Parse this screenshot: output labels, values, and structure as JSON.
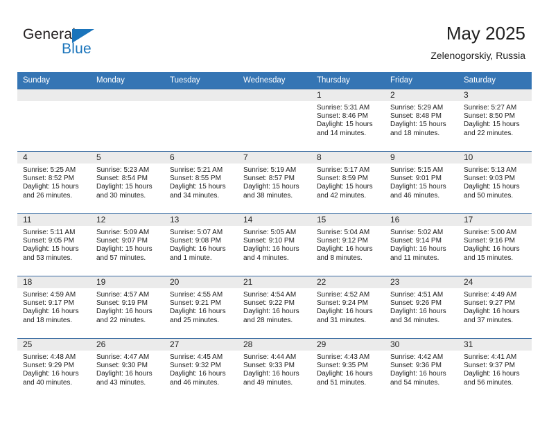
{
  "brand": {
    "name_top": "General",
    "name_bottom": "Blue",
    "accent_color": "#1a74bb"
  },
  "header": {
    "title": "May 2025",
    "subtitle": "Zelenogorskiy, Russia"
  },
  "theme": {
    "header_row_bg": "#3575b4",
    "grid_line": "#35689f",
    "daynum_band": "#ebebeb"
  },
  "weekdays": [
    "Sunday",
    "Monday",
    "Tuesday",
    "Wednesday",
    "Thursday",
    "Friday",
    "Saturday"
  ],
  "weeks": [
    [
      {
        "day": "",
        "empty": true
      },
      {
        "day": "",
        "empty": true
      },
      {
        "day": "",
        "empty": true
      },
      {
        "day": "",
        "empty": true
      },
      {
        "day": "1",
        "sunrise": "Sunrise: 5:31 AM",
        "sunset": "Sunset: 8:46 PM",
        "daylight1": "Daylight: 15 hours",
        "daylight2": "and 14 minutes."
      },
      {
        "day": "2",
        "sunrise": "Sunrise: 5:29 AM",
        "sunset": "Sunset: 8:48 PM",
        "daylight1": "Daylight: 15 hours",
        "daylight2": "and 18 minutes."
      },
      {
        "day": "3",
        "sunrise": "Sunrise: 5:27 AM",
        "sunset": "Sunset: 8:50 PM",
        "daylight1": "Daylight: 15 hours",
        "daylight2": "and 22 minutes."
      }
    ],
    [
      {
        "day": "4",
        "sunrise": "Sunrise: 5:25 AM",
        "sunset": "Sunset: 8:52 PM",
        "daylight1": "Daylight: 15 hours",
        "daylight2": "and 26 minutes."
      },
      {
        "day": "5",
        "sunrise": "Sunrise: 5:23 AM",
        "sunset": "Sunset: 8:54 PM",
        "daylight1": "Daylight: 15 hours",
        "daylight2": "and 30 minutes."
      },
      {
        "day": "6",
        "sunrise": "Sunrise: 5:21 AM",
        "sunset": "Sunset: 8:55 PM",
        "daylight1": "Daylight: 15 hours",
        "daylight2": "and 34 minutes."
      },
      {
        "day": "7",
        "sunrise": "Sunrise: 5:19 AM",
        "sunset": "Sunset: 8:57 PM",
        "daylight1": "Daylight: 15 hours",
        "daylight2": "and 38 minutes."
      },
      {
        "day": "8",
        "sunrise": "Sunrise: 5:17 AM",
        "sunset": "Sunset: 8:59 PM",
        "daylight1": "Daylight: 15 hours",
        "daylight2": "and 42 minutes."
      },
      {
        "day": "9",
        "sunrise": "Sunrise: 5:15 AM",
        "sunset": "Sunset: 9:01 PM",
        "daylight1": "Daylight: 15 hours",
        "daylight2": "and 46 minutes."
      },
      {
        "day": "10",
        "sunrise": "Sunrise: 5:13 AM",
        "sunset": "Sunset: 9:03 PM",
        "daylight1": "Daylight: 15 hours",
        "daylight2": "and 50 minutes."
      }
    ],
    [
      {
        "day": "11",
        "sunrise": "Sunrise: 5:11 AM",
        "sunset": "Sunset: 9:05 PM",
        "daylight1": "Daylight: 15 hours",
        "daylight2": "and 53 minutes."
      },
      {
        "day": "12",
        "sunrise": "Sunrise: 5:09 AM",
        "sunset": "Sunset: 9:07 PM",
        "daylight1": "Daylight: 15 hours",
        "daylight2": "and 57 minutes."
      },
      {
        "day": "13",
        "sunrise": "Sunrise: 5:07 AM",
        "sunset": "Sunset: 9:08 PM",
        "daylight1": "Daylight: 16 hours",
        "daylight2": "and 1 minute."
      },
      {
        "day": "14",
        "sunrise": "Sunrise: 5:05 AM",
        "sunset": "Sunset: 9:10 PM",
        "daylight1": "Daylight: 16 hours",
        "daylight2": "and 4 minutes."
      },
      {
        "day": "15",
        "sunrise": "Sunrise: 5:04 AM",
        "sunset": "Sunset: 9:12 PM",
        "daylight1": "Daylight: 16 hours",
        "daylight2": "and 8 minutes."
      },
      {
        "day": "16",
        "sunrise": "Sunrise: 5:02 AM",
        "sunset": "Sunset: 9:14 PM",
        "daylight1": "Daylight: 16 hours",
        "daylight2": "and 11 minutes."
      },
      {
        "day": "17",
        "sunrise": "Sunrise: 5:00 AM",
        "sunset": "Sunset: 9:16 PM",
        "daylight1": "Daylight: 16 hours",
        "daylight2": "and 15 minutes."
      }
    ],
    [
      {
        "day": "18",
        "sunrise": "Sunrise: 4:59 AM",
        "sunset": "Sunset: 9:17 PM",
        "daylight1": "Daylight: 16 hours",
        "daylight2": "and 18 minutes."
      },
      {
        "day": "19",
        "sunrise": "Sunrise: 4:57 AM",
        "sunset": "Sunset: 9:19 PM",
        "daylight1": "Daylight: 16 hours",
        "daylight2": "and 22 minutes."
      },
      {
        "day": "20",
        "sunrise": "Sunrise: 4:55 AM",
        "sunset": "Sunset: 9:21 PM",
        "daylight1": "Daylight: 16 hours",
        "daylight2": "and 25 minutes."
      },
      {
        "day": "21",
        "sunrise": "Sunrise: 4:54 AM",
        "sunset": "Sunset: 9:22 PM",
        "daylight1": "Daylight: 16 hours",
        "daylight2": "and 28 minutes."
      },
      {
        "day": "22",
        "sunrise": "Sunrise: 4:52 AM",
        "sunset": "Sunset: 9:24 PM",
        "daylight1": "Daylight: 16 hours",
        "daylight2": "and 31 minutes."
      },
      {
        "day": "23",
        "sunrise": "Sunrise: 4:51 AM",
        "sunset": "Sunset: 9:26 PM",
        "daylight1": "Daylight: 16 hours",
        "daylight2": "and 34 minutes."
      },
      {
        "day": "24",
        "sunrise": "Sunrise: 4:49 AM",
        "sunset": "Sunset: 9:27 PM",
        "daylight1": "Daylight: 16 hours",
        "daylight2": "and 37 minutes."
      }
    ],
    [
      {
        "day": "25",
        "sunrise": "Sunrise: 4:48 AM",
        "sunset": "Sunset: 9:29 PM",
        "daylight1": "Daylight: 16 hours",
        "daylight2": "and 40 minutes."
      },
      {
        "day": "26",
        "sunrise": "Sunrise: 4:47 AM",
        "sunset": "Sunset: 9:30 PM",
        "daylight1": "Daylight: 16 hours",
        "daylight2": "and 43 minutes."
      },
      {
        "day": "27",
        "sunrise": "Sunrise: 4:45 AM",
        "sunset": "Sunset: 9:32 PM",
        "daylight1": "Daylight: 16 hours",
        "daylight2": "and 46 minutes."
      },
      {
        "day": "28",
        "sunrise": "Sunrise: 4:44 AM",
        "sunset": "Sunset: 9:33 PM",
        "daylight1": "Daylight: 16 hours",
        "daylight2": "and 49 minutes."
      },
      {
        "day": "29",
        "sunrise": "Sunrise: 4:43 AM",
        "sunset": "Sunset: 9:35 PM",
        "daylight1": "Daylight: 16 hours",
        "daylight2": "and 51 minutes."
      },
      {
        "day": "30",
        "sunrise": "Sunrise: 4:42 AM",
        "sunset": "Sunset: 9:36 PM",
        "daylight1": "Daylight: 16 hours",
        "daylight2": "and 54 minutes."
      },
      {
        "day": "31",
        "sunrise": "Sunrise: 4:41 AM",
        "sunset": "Sunset: 9:37 PM",
        "daylight1": "Daylight: 16 hours",
        "daylight2": "and 56 minutes."
      }
    ]
  ]
}
